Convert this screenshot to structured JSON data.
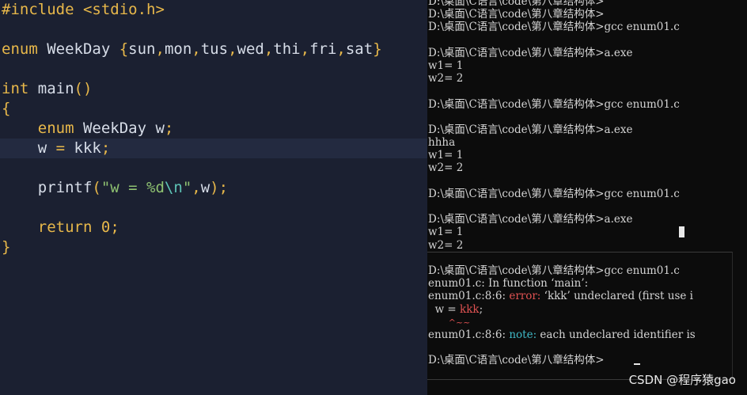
{
  "editor": {
    "lines": [
      [
        {
          "t": "#include <stdio.h>",
          "c": "kw"
        }
      ],
      [],
      [
        {
          "t": "enum",
          "c": "kw"
        },
        {
          "t": " WeekDay ",
          "c": ""
        },
        {
          "t": "{",
          "c": "pun"
        },
        {
          "t": "sun",
          "c": ""
        },
        {
          "t": ",",
          "c": "pun"
        },
        {
          "t": "mon",
          "c": ""
        },
        {
          "t": ",",
          "c": "pun"
        },
        {
          "t": "tus",
          "c": ""
        },
        {
          "t": ",",
          "c": "pun"
        },
        {
          "t": "wed",
          "c": ""
        },
        {
          "t": ",",
          "c": "pun"
        },
        {
          "t": "thi",
          "c": ""
        },
        {
          "t": ",",
          "c": "pun"
        },
        {
          "t": "fri",
          "c": ""
        },
        {
          "t": ",",
          "c": "pun"
        },
        {
          "t": "sat",
          "c": ""
        },
        {
          "t": "}",
          "c": "pun"
        }
      ],
      [],
      [
        {
          "t": "int",
          "c": "kw"
        },
        {
          "t": " main",
          "c": ""
        },
        {
          "t": "()",
          "c": "pun"
        }
      ],
      [
        {
          "t": "{",
          "c": "pun"
        }
      ],
      [
        {
          "t": "    ",
          "c": ""
        },
        {
          "t": "enum",
          "c": "kw"
        },
        {
          "t": " WeekDay w",
          "c": ""
        },
        {
          "t": ";",
          "c": "pun"
        }
      ],
      [
        {
          "t": "    w ",
          "c": ""
        },
        {
          "t": "=",
          "c": "pun"
        },
        {
          "t": " kkk",
          "c": ""
        },
        {
          "t": ";",
          "c": "pun"
        }
      ],
      [],
      [
        {
          "t": "    printf",
          "c": ""
        },
        {
          "t": "(",
          "c": "pun"
        },
        {
          "t": "\"w = %d",
          "c": "str"
        },
        {
          "t": "\\n",
          "c": "esc"
        },
        {
          "t": "\"",
          "c": "str"
        },
        {
          "t": ",",
          "c": "pun"
        },
        {
          "t": "w",
          "c": ""
        },
        {
          "t": ");",
          "c": "pun"
        }
      ],
      [],
      [
        {
          "t": "    ",
          "c": ""
        },
        {
          "t": "return",
          "c": "kw"
        },
        {
          "t": " ",
          "c": ""
        },
        {
          "t": "0",
          "c": "num"
        },
        {
          "t": ";",
          "c": "pun"
        }
      ],
      [
        {
          "t": "}",
          "c": "pun"
        }
      ]
    ],
    "current_line": 7
  },
  "terminal": {
    "lines": [
      [
        {
          "t": "D:\\桌面\\C语言\\code\\第八章结构体>",
          "c": ""
        }
      ],
      [
        {
          "t": "D:\\桌面\\C语言\\code\\第八章结构体>",
          "c": ""
        }
      ],
      [
        {
          "t": "D:\\桌面\\C语言\\code\\第八章结构体>gcc enum01.c",
          "c": ""
        }
      ],
      [],
      [
        {
          "t": "D:\\桌面\\C语言\\code\\第八章结构体>a.exe",
          "c": ""
        }
      ],
      [
        {
          "t": "w1= 1",
          "c": ""
        }
      ],
      [
        {
          "t": "w2= 2",
          "c": ""
        }
      ],
      [],
      [
        {
          "t": "D:\\桌面\\C语言\\code\\第八章结构体>gcc enum01.c",
          "c": ""
        }
      ],
      [],
      [
        {
          "t": "D:\\桌面\\C语言\\code\\第八章结构体>a.exe",
          "c": ""
        }
      ],
      [
        {
          "t": "hhha",
          "c": ""
        }
      ],
      [
        {
          "t": "w1= 1",
          "c": ""
        }
      ],
      [
        {
          "t": "w2= 2",
          "c": ""
        }
      ],
      [],
      [
        {
          "t": "D:\\桌面\\C语言\\code\\第八章结构体>gcc enum01.c",
          "c": ""
        }
      ],
      [],
      [
        {
          "t": "D:\\桌面\\C语言\\code\\第八章结构体>a.exe",
          "c": ""
        }
      ],
      [
        {
          "t": "w1= 1",
          "c": ""
        }
      ],
      [
        {
          "t": "w2= 2",
          "c": ""
        }
      ],
      [],
      [
        {
          "t": "D:\\桌面\\C语言\\code\\第八章结构体>gcc enum01.c",
          "c": ""
        }
      ],
      [
        {
          "t": "enum01.c: In function ‘main’:",
          "c": ""
        }
      ],
      [
        {
          "t": "enum01.c:8:6: ",
          "c": ""
        },
        {
          "t": "error: ",
          "c": "err"
        },
        {
          "t": "‘kkk’ undeclared (first use i",
          "c": ""
        }
      ],
      [
        {
          "t": "  w = ",
          "c": ""
        },
        {
          "t": "kkk",
          "c": "err"
        },
        {
          "t": ";",
          "c": ""
        }
      ],
      [
        {
          "t": "      ",
          "c": ""
        },
        {
          "t": "^~~",
          "c": "tilde"
        }
      ],
      [
        {
          "t": "enum01.c:8:6: ",
          "c": ""
        },
        {
          "t": "note: ",
          "c": "note"
        },
        {
          "t": "each undeclared identifier is",
          "c": ""
        }
      ],
      [],
      [
        {
          "t": "D:\\桌面\\C语言\\code\\第八章结构体>",
          "c": ""
        }
      ]
    ]
  },
  "watermark": "CSDN @程序猿gao"
}
